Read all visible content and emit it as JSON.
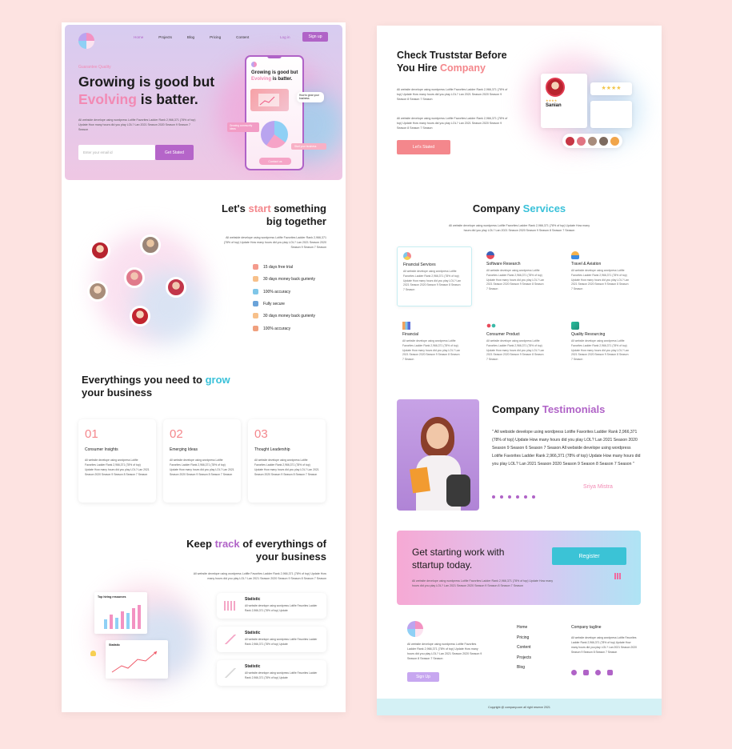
{
  "left": {
    "nav": {
      "links": [
        "Home",
        "Projects",
        "Blog",
        "Pricing",
        "Content"
      ],
      "login": "Log in",
      "signup": "Sign up"
    },
    "hero": {
      "eyebrow": "Guarantee Quality",
      "title_line1": "Growing is good but",
      "title_word": "Evolving",
      "title_rest": " is batter.",
      "desc": "All webside develope using wordpress Lotifie Favorites Ladder Rank 2,966,371 (78% of top) Update How many hours did you play LOL? Lan 2021 Season 2020 Season 9 Season 7 Season",
      "email_placeholder": "Enter your email id",
      "cta": "Get Stated",
      "phone": {
        "headline_a": "Growing is good but",
        "headline_word": "Evolving",
        "headline_b": " is batter.",
        "tag1": "How to grow your business",
        "tag2": "Growing community Ideas",
        "tag3": "Start your business",
        "button": "Contact us"
      }
    },
    "start": {
      "title_a": "Let's ",
      "title_word": "start",
      "title_b": " something",
      "title_line2": "big together",
      "desc": "All webside develope using wordpress Lotifie Favorites Ladder Rank 2,966,371 (78% of top) Update How many hours did you play LOL? Lan 2021 Season 2020 Season 9 Season 7 Season",
      "features": [
        "15 days free trial",
        "30 days money back gurienty",
        "100% accuracy",
        "Fully secure",
        "30 days money back gurienty",
        "100% accuracy"
      ]
    },
    "grow": {
      "title_a": "Everythings you need to ",
      "title_word": "grow",
      "title_line2": "your business",
      "cards": [
        {
          "num": "01",
          "title": "Consumer Insights",
          "desc": "All website develope using wordpress Lotifie Favorites Ladder Rank 2,966,371 (78% of top) Update How many hours did you play LOL? Lan 2021 Season 2020 Season 9 Season 8 Season 7 Season"
        },
        {
          "num": "02",
          "title": "Emerging Ideas",
          "desc": "All website develope using wordpress Lotifie Favorites Ladder Rank 2,966,371 (78% of top) Update How many hours did you play LOL? Lan 2021 Season 2020 Season 9 Season 8 Season 7 Season"
        },
        {
          "num": "03",
          "title": "Thought Leadership",
          "desc": "All website develope using wordpress Lotifie Favorites Ladder Rank 2,966,371 (78% of top) Update How many hours did you play LOL? Lan 2021 Season 2020 Season 9 Season 8 Season 7 Season"
        }
      ]
    },
    "track": {
      "title_a": "Keep ",
      "title_word": "track",
      "title_b": " of everythings of",
      "title_line2": "your business",
      "desc": "All website develope using wordpress Lotifie Favorites Ladder Rank 2,966,371 (78% of top) Update How many hours did you play LOL? Lan 2021 Season 2020 Season 9 Season 8 Season 7 Season",
      "chart1_title": "Top hiring resources",
      "chart2_title": "Statistic",
      "stats": [
        {
          "title": "Statistic",
          "desc": "All website develope using wordpress Lotifie Favorites Ladder Rank 2,966,371 (78% of top) Update"
        },
        {
          "title": "Statistic",
          "desc": "All website develope using wordpress Lotifie Favorites Ladder Rank 2,966,371 (78% of top) Update"
        },
        {
          "title": "Statistic",
          "desc": "All website develope using wordpress Lotifie Favorites Ladder Rank 2,966,371 (78% of top) Update"
        }
      ]
    }
  },
  "right": {
    "check": {
      "title_line1": "Check Truststar Before",
      "title_b": "You Hire ",
      "title_word": "Company",
      "desc1": "All website develope using wordpress Lotifie Favorites Ladder Rank 2,966,371 (78% of top) Update How many hours did you play LOL? Lan 2021 Season 2020 Season 9 Season 8 Season 7 Season",
      "desc2": "All website develope using wordpress Lotifie Favorites Ladder Rank 2,966,371 (78% of top) Update How many hours did you play LOL? Lan 2021 Season 2020 Season 9 Season 8 Season 7 Season",
      "cta": "Let's Stated",
      "reviewer": "Sanian"
    },
    "services": {
      "title_a": "Company ",
      "title_word": "Services",
      "desc": "All website develope using wordpress Lotifie Favorites Ladder Rank 2,966,371 (78% of top) Update How many hours did you play LOL? Lan 2021 Season 2020 Season 9 Season 8 Season 7 Season",
      "items": [
        {
          "title": "Financial Services",
          "desc": "All website develope using wordpress Lotifie Favorites Ladder Rank 2,966,371 (78% of top) Update How many hours did you play LOL? Lan 2021 Season 2020 Season 9 Season 8 Season 7 Season"
        },
        {
          "title": "Software Research",
          "desc": "All website develope using wordpress Lotifie Favorites Ladder Rank 2,966,371 (78% of top) Update How many hours did you play LOL? Lan 2021 Season 2020 Season 9 Season 8 Season 7 Season"
        },
        {
          "title": "Travel & Aviation",
          "desc": "All website develope using wordpress Lotifie Favorites Ladder Rank 2,966,371 (78% of top) Update How many hours did you play LOL? Lan 2021 Season 2020 Season 9 Season 8 Season 7 Season"
        },
        {
          "title": "Financial",
          "desc": "All website develope using wordpress Lotifie Favorites Ladder Rank 2,966,371 (78% of top) Update How many hours did you play LOL? Lan 2021 Season 2020 Season 9 Season 8 Season 7 Season"
        },
        {
          "title": "Consumer Product",
          "desc": "All website develope using wordpress Lotifie Favorites Ladder Rank 2,966,371 (78% of top) Update How many hours did you play LOL? Lan 2021 Season 2020 Season 9 Season 8 Season 7 Season"
        },
        {
          "title": "Quality Resourcing",
          "desc": "All website develope using wordpress Lotifie Favorites Ladder Rank 2,966,371 (78% of top) Update How many hours did you play LOL? Lan 2021 Season 2020 Season 9 Season 8 Season 7 Season"
        }
      ]
    },
    "testimonials": {
      "title_a": "Company ",
      "title_word": "Testimonials",
      "quote": "\" All webside develope using wordpress Lotifie Favorites Ladder Rank 2,966,371 (78% of top) Update How many hours did you play LOL? Lan 2021 Season 2020 Season 9 Season 6 Season 7 Season All webside develope using wordpress Lotifie Favorites Ladder Rank 2,966,371 (78% of top) Update How many hours did you play LOL? Lan 2021 Season 2020 Season 9 Season 8 Season 7 Season \"",
      "author": "Sriya Mistra"
    },
    "cta": {
      "title_line1": "Get starting work with",
      "title_line2": "sttartup today.",
      "desc": "All website develope using wordpress Lotifie Favorites Ladder Rank 2,966,371 (78% of top) Update How many hours did you play LOL? Lan 2021 Season 2020 Season 9 Season 8 Season 7 Season",
      "button": "Register"
    },
    "footer": {
      "desc": "All website develope using wordpress Lotifie Favorites Ladder Rank 2,966,371 (78% of top) Update How many hours did you play LOL? Lan 2021 Season 2020 Season 9 Season 8 Season 7 Season",
      "signup": "Sign Up",
      "links": [
        "Home",
        "Pricing",
        "Content",
        "Projects",
        "Blog"
      ],
      "tagline_title": "Company tagline",
      "tagline_desc": "All website develope using wordpress Lotifie Favorites Ladder Rank 2,966,371 (78% of top) Update How many hours did you play LOL? Lan 2021 Season 2020 Season 9 Season 8 Season 7 Season",
      "copyright": "Copyright @ company.com all right reserve 2021"
    }
  },
  "colors": {
    "pink": "#f28ab4",
    "teal": "#39c1d9",
    "purple": "#b063c7",
    "orange": "#f4878c"
  }
}
